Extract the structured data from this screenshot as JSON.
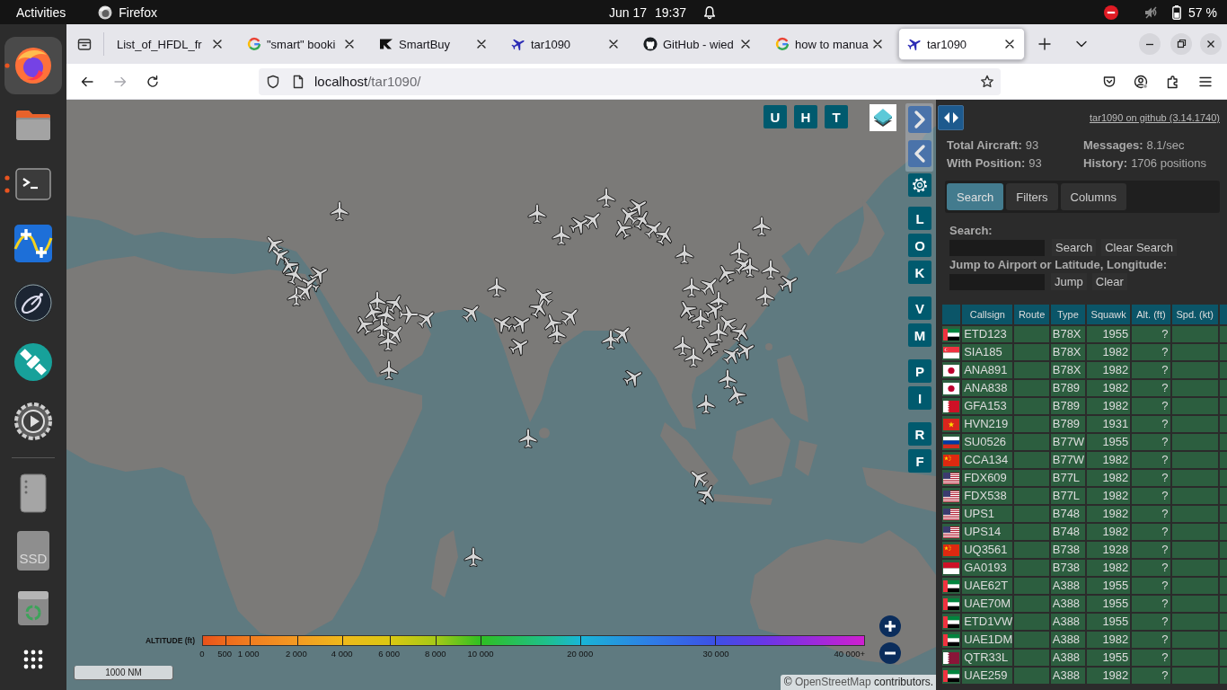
{
  "top_bar": {
    "activities": "Activities",
    "app_name": "Firefox",
    "date": "Jun 17",
    "time": "19:37",
    "do_not_disturb": true,
    "sound_muted": true,
    "battery": "57 %"
  },
  "dock": {
    "apps": [
      {
        "kind": "browser",
        "selected": true,
        "running": true,
        "multiple_windows": false
      },
      {
        "kind": "files",
        "selected": false,
        "running": false,
        "multiple_windows": false
      },
      {
        "kind": "terminal",
        "selected": false,
        "running": true,
        "multiple_windows": true
      },
      {
        "kind": "plot",
        "selected": false,
        "running": false,
        "multiple_windows": false
      },
      {
        "kind": "dish",
        "selected": false,
        "running": false,
        "multiple_windows": false
      },
      {
        "kind": "satellite",
        "selected": false,
        "running": false,
        "multiple_windows": false
      },
      {
        "kind": "media",
        "selected": false,
        "running": false,
        "multiple_windows": false
      }
    ],
    "devices": [
      {
        "kind": "drive"
      },
      {
        "kind": "ssd",
        "label": "SSD"
      },
      {
        "kind": "trash"
      }
    ]
  },
  "browser_tabs": [
    {
      "title": "List_of_HFDL_fr",
      "kind": "blank",
      "selected": false
    },
    {
      "title": "\"smart\" booki",
      "kind": "google",
      "selected": false
    },
    {
      "title": "SmartBuy",
      "kind": "smartbuy",
      "selected": false
    },
    {
      "title": "tar1090",
      "kind": "plane",
      "selected": false
    },
    {
      "title": "GitHub - wied",
      "kind": "github",
      "selected": false
    },
    {
      "title": "how to manua",
      "kind": "google",
      "selected": false
    },
    {
      "title": "tar1090",
      "kind": "plane",
      "selected": true
    }
  ],
  "nav_buttons": [
    {
      "kind": "back",
      "disabled": false
    },
    {
      "kind": "forward",
      "disabled": true
    },
    {
      "kind": "reload",
      "disabled": false
    }
  ],
  "address_bar": {
    "host": "localhost",
    "path": "/tar1090/"
  },
  "map": {
    "top_buttons": [
      "U",
      "H",
      "T"
    ],
    "button_groups": [
      [
        "L",
        "O",
        "K"
      ],
      [
        "V",
        "M"
      ],
      [
        "P",
        "I"
      ],
      [
        "R",
        "F"
      ]
    ],
    "altitude_legend": {
      "title": "ALTITUDE (ft)",
      "ticks": [
        "0",
        "500",
        "1 000",
        "2 000",
        "4 000",
        "6 000",
        "8 000",
        "10 000",
        "20 000",
        "30 000",
        "40 000+"
      ]
    },
    "scale": "1000 NM",
    "attribution": {
      "prefix": "©",
      "link": "OpenStreetMap",
      "suffix": "contributors."
    }
  },
  "panel": {
    "github_link": "tar1090 on github (3.14.1740)",
    "stats": [
      {
        "label": "Total Aircraft:",
        "value": "93"
      },
      {
        "label": "Messages:",
        "value": "8.1/sec"
      },
      {
        "label": "With Position:",
        "value": "93"
      },
      {
        "label": "History:",
        "value": "1706 positions"
      }
    ],
    "tabs": [
      {
        "label": "Search",
        "selected": true
      },
      {
        "label": "Filters",
        "selected": false
      },
      {
        "label": "Columns",
        "selected": false
      }
    ],
    "search": {
      "label": "Search:",
      "button": "Search",
      "clear_button": "Clear Search"
    },
    "jump": {
      "label": "Jump to Airport or Latitude, Longitude:",
      "button": "Jump",
      "clear_button": "Clear"
    },
    "table": {
      "columns": [
        "Callsign",
        "Route",
        "Type",
        "Squawk",
        "Alt. (ft)",
        "Spd. (kt)"
      ],
      "rows": [
        {
          "kind": "emirates",
          "callsign": "ETD123",
          "type": "B78X",
          "squawk": "1955",
          "altitude": "?"
        },
        {
          "kind": "singapore",
          "callsign": "SIA185",
          "type": "B78X",
          "squawk": "1982",
          "altitude": "?"
        },
        {
          "kind": "japan",
          "callsign": "ANA891",
          "type": "B78X",
          "squawk": "1982",
          "altitude": "?"
        },
        {
          "kind": "japan",
          "callsign": "ANA838",
          "type": "B789",
          "squawk": "1982",
          "altitude": "?"
        },
        {
          "kind": "bahrain",
          "callsign": "GFA153",
          "type": "B789",
          "squawk": "1982",
          "altitude": "?"
        },
        {
          "kind": "vietnam",
          "callsign": "HVN219",
          "type": "B789",
          "squawk": "1931",
          "altitude": "?"
        },
        {
          "kind": "russia",
          "callsign": "SU0526",
          "type": "B77W",
          "squawk": "1955",
          "altitude": "?"
        },
        {
          "kind": "china",
          "callsign": "CCA134",
          "type": "B77W",
          "squawk": "1982",
          "altitude": "?"
        },
        {
          "kind": "usa",
          "callsign": "FDX609",
          "type": "B77L",
          "squawk": "1982",
          "altitude": "?"
        },
        {
          "kind": "usa",
          "callsign": "FDX538",
          "type": "B77L",
          "squawk": "1982",
          "altitude": "?"
        },
        {
          "kind": "usa",
          "callsign": "UPS1",
          "type": "B748",
          "squawk": "1982",
          "altitude": "?"
        },
        {
          "kind": "usa",
          "callsign": "UPS14",
          "type": "B748",
          "squawk": "1982",
          "altitude": "?"
        },
        {
          "kind": "china",
          "callsign": "UQ3561",
          "type": "B738",
          "squawk": "1928",
          "altitude": "?"
        },
        {
          "kind": "indonesia",
          "callsign": "GA0193",
          "type": "B738",
          "squawk": "1982",
          "altitude": "?"
        },
        {
          "kind": "emirates",
          "callsign": "UAE62T",
          "type": "A388",
          "squawk": "1955",
          "altitude": "?"
        },
        {
          "kind": "emirates",
          "callsign": "UAE70M",
          "type": "A388",
          "squawk": "1955",
          "altitude": "?"
        },
        {
          "kind": "emirates",
          "callsign": "ETD1VW",
          "type": "A388",
          "squawk": "1955",
          "altitude": "?"
        },
        {
          "kind": "emirates",
          "callsign": "UAE1DM",
          "type": "A388",
          "squawk": "1982",
          "altitude": "?"
        },
        {
          "kind": "qatar",
          "callsign": "QTR33L",
          "type": "A388",
          "squawk": "1955",
          "altitude": "?"
        },
        {
          "kind": "emirates",
          "callsign": "UAE259",
          "type": "A388",
          "squawk": "1982",
          "altitude": "?"
        }
      ]
    }
  }
}
